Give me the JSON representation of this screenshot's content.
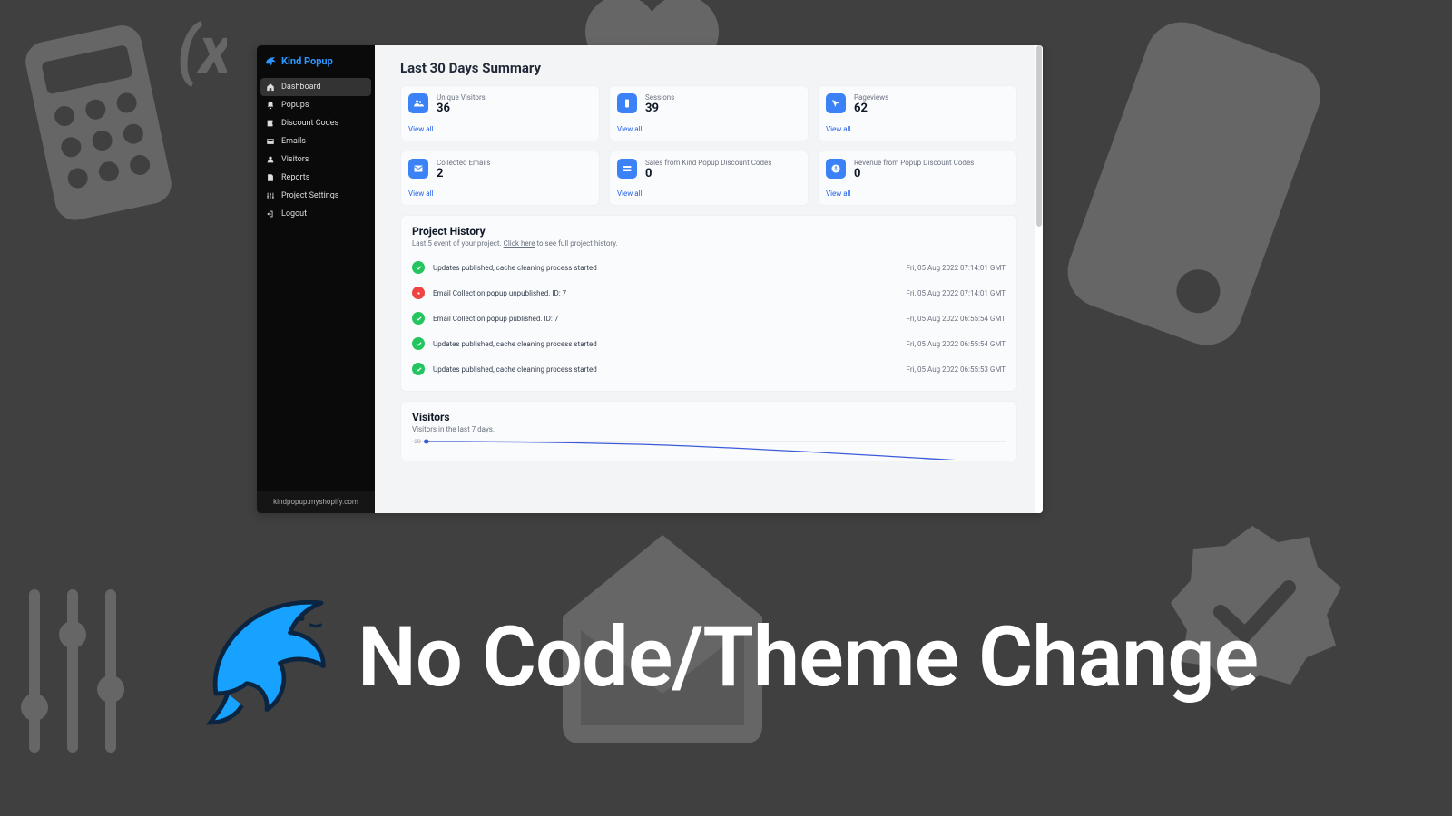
{
  "app": {
    "title": "Kind Popup"
  },
  "sidebar": {
    "items": [
      {
        "label": "Dashboard",
        "icon": "home-icon"
      },
      {
        "label": "Popups",
        "icon": "bell-icon"
      },
      {
        "label": "Discount Codes",
        "icon": "tag-icon"
      },
      {
        "label": "Emails",
        "icon": "mail-icon"
      },
      {
        "label": "Visitors",
        "icon": "user-icon"
      },
      {
        "label": "Reports",
        "icon": "report-icon"
      },
      {
        "label": "Project Settings",
        "icon": "sliders-icon"
      },
      {
        "label": "Logout",
        "icon": "logout-icon"
      }
    ],
    "footer": "kindpopup.myshopify.com"
  },
  "summary": {
    "title": "Last 30 Days Summary",
    "view_all": "View all",
    "cards": [
      {
        "label": "Unique Visitors",
        "value": "36",
        "icon": "visitors-icon"
      },
      {
        "label": "Sessions",
        "value": "39",
        "icon": "sessions-icon"
      },
      {
        "label": "Pageviews",
        "value": "62",
        "icon": "pageviews-icon"
      },
      {
        "label": "Collected Emails",
        "value": "2",
        "icon": "mail-icon"
      },
      {
        "label": "Sales from Kind Popup Discount Codes",
        "value": "0",
        "icon": "card-icon"
      },
      {
        "label": "Revenue from Popup Discount Codes",
        "value": "0",
        "icon": "dollar-icon"
      }
    ]
  },
  "history": {
    "title": "Project History",
    "subtitle_pre": "Last 5 event of your project. ",
    "subtitle_link": "Click here",
    "subtitle_post": " to see full project history.",
    "rows": [
      {
        "status": "ok",
        "text": "Updates published, cache cleaning process started",
        "time": "Fri, 05 Aug 2022 07:14:01 GMT"
      },
      {
        "status": "err",
        "text": "Email Collection popup unpublished. ID: 7",
        "time": "Fri, 05 Aug 2022 07:14:01 GMT"
      },
      {
        "status": "ok",
        "text": "Email Collection popup published. ID: 7",
        "time": "Fri, 05 Aug 2022 06:55:54 GMT"
      },
      {
        "status": "ok",
        "text": "Updates published, cache cleaning process started",
        "time": "Fri, 05 Aug 2022 06:55:54 GMT"
      },
      {
        "status": "ok",
        "text": "Updates published, cache cleaning process started",
        "time": "Fri, 05 Aug 2022 06:55:53 GMT"
      }
    ]
  },
  "visitors": {
    "title": "Visitors",
    "subtitle": "Visitors in the last 7 days.",
    "y_tick": "20"
  },
  "tagline": "No Code/Theme Change"
}
